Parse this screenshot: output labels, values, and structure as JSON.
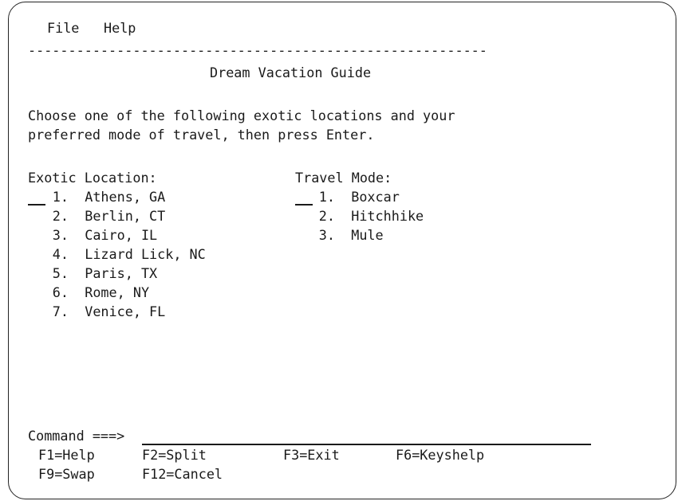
{
  "menu_bar": {
    "items": [
      "File",
      "Help"
    ],
    "separator": "---------------------------------------------------------"
  },
  "panel_title": "Dream Vacation Guide",
  "instructions": [
    "Choose one of the following exotic locations and your",
    "preferred mode of travel, then press Enter."
  ],
  "location_group": {
    "heading": "Exotic Location:",
    "options": [
      {
        "number": "1.",
        "label": "Athens, GA"
      },
      {
        "number": "2.",
        "label": "Berlin, CT"
      },
      {
        "number": "3.",
        "label": "Cairo, IL"
      },
      {
        "number": "4.",
        "label": "Lizard Lick, NC"
      },
      {
        "number": "5.",
        "label": "Paris, TX"
      },
      {
        "number": "6.",
        "label": "Rome, NY"
      },
      {
        "number": "7.",
        "label": "Venice, FL"
      }
    ]
  },
  "travel_group": {
    "heading": "Travel Mode:",
    "options": [
      {
        "number": "1.",
        "label": "Boxcar"
      },
      {
        "number": "2.",
        "label": "Hitchhike"
      },
      {
        "number": "3.",
        "label": "Mule"
      }
    ]
  },
  "command": {
    "prompt": "Command ===>",
    "value": ""
  },
  "function_keys": [
    [
      "F1=Help",
      "F2=Split",
      "F3=Exit",
      "F6=Keyshelp"
    ],
    [
      "F9=Swap",
      "F12=Cancel"
    ]
  ]
}
